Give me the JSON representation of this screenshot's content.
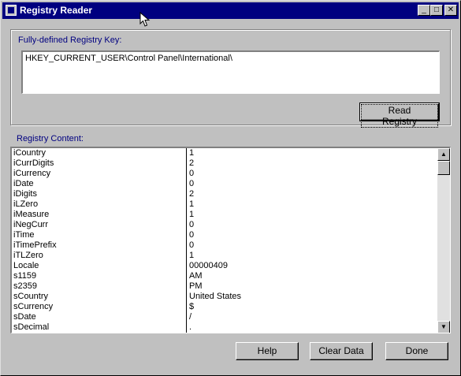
{
  "window": {
    "title": "Registry Reader",
    "controls": {
      "minimize": "_",
      "maximize": "□",
      "close": "✕"
    }
  },
  "key_group": {
    "label": "Fully-defined Registry Key:",
    "key_value": "HKEY_CURRENT_USER\\Control Panel\\International\\",
    "read_button": "Read Registry"
  },
  "content": {
    "label": "Registry Content:",
    "rows": [
      {
        "name": "iCountry",
        "value": "1"
      },
      {
        "name": "iCurrDigits",
        "value": "2"
      },
      {
        "name": "iCurrency",
        "value": "0"
      },
      {
        "name": "iDate",
        "value": "0"
      },
      {
        "name": "iDigits",
        "value": "2"
      },
      {
        "name": "iLZero",
        "value": "1"
      },
      {
        "name": "iMeasure",
        "value": "1"
      },
      {
        "name": "iNegCurr",
        "value": "0"
      },
      {
        "name": "iTime",
        "value": "0"
      },
      {
        "name": "iTimePrefix",
        "value": "0"
      },
      {
        "name": "iTLZero",
        "value": "1"
      },
      {
        "name": "Locale",
        "value": "00000409"
      },
      {
        "name": "s1159",
        "value": "AM"
      },
      {
        "name": "s2359",
        "value": "PM"
      },
      {
        "name": "sCountry",
        "value": "United States"
      },
      {
        "name": "sCurrency",
        "value": "$"
      },
      {
        "name": "sDate",
        "value": "/"
      },
      {
        "name": "sDecimal",
        "value": "."
      }
    ]
  },
  "buttons": {
    "help": "Help",
    "clear": "Clear Data",
    "done": "Done"
  },
  "icons": {
    "app": "app-icon",
    "scroll_up": "▲",
    "scroll_down": "▼"
  }
}
